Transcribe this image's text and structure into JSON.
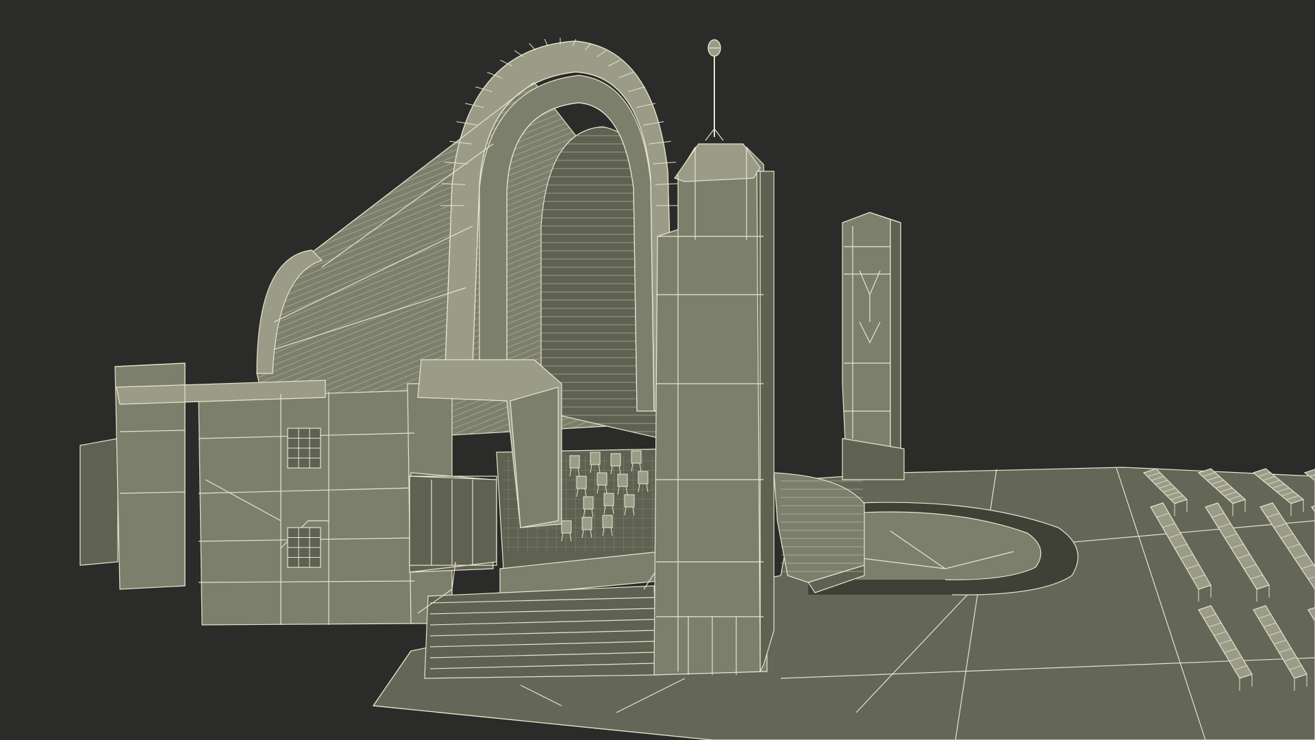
{
  "scene": {
    "kind": "3d-wireframe-render",
    "subject": "art-deco-bandshell",
    "colors": {
      "background": "#2b2c29",
      "surface": "#7d7f6d",
      "surface_dark": "#5f6152",
      "surface_light": "#9a9c87",
      "ground": "#646657",
      "wire": "#e8e6cf",
      "shadow": "#3f4137"
    },
    "elements": [
      "shell-arch",
      "main-tower",
      "rear-tower",
      "side-building",
      "stage",
      "front-stairs",
      "fountain-pool",
      "plaza-floor",
      "bench-rows",
      "stage-chairs",
      "antenna-orb"
    ]
  }
}
